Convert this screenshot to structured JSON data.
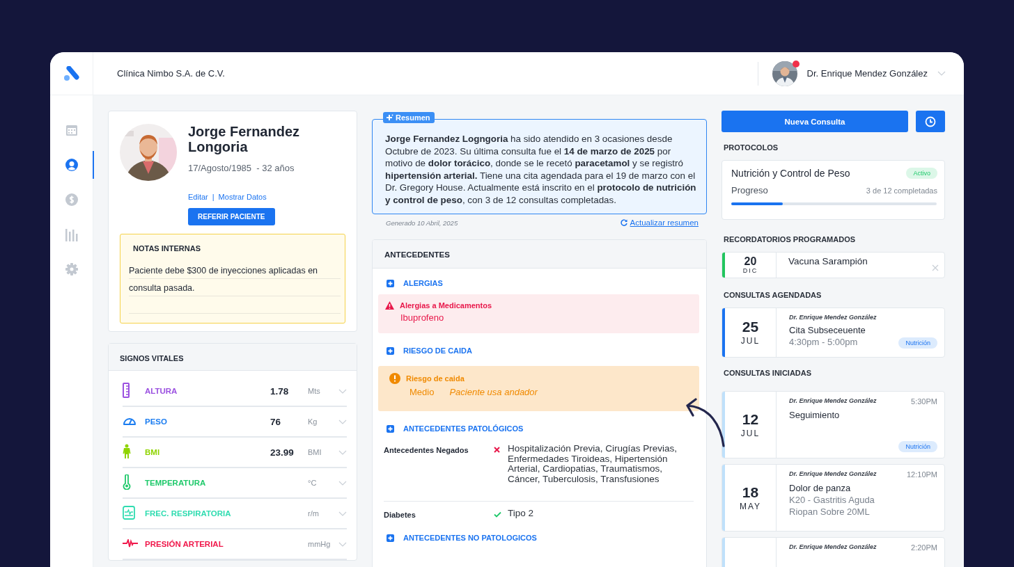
{
  "header": {
    "clinic": "Clínica Nimbo S.A. de C.V.",
    "user": "Dr. Enrique Mendez González",
    "notification": true
  },
  "sidebar": {
    "items": [
      {
        "kind": "calendar",
        "selected": false
      },
      {
        "kind": "user",
        "selected": true
      },
      {
        "kind": "money",
        "selected": false
      },
      {
        "kind": "chart",
        "selected": false
      },
      {
        "kind": "settings",
        "selected": false
      }
    ]
  },
  "patient": {
    "name": "Jorge Fernandez Longoria",
    "birth": "17/Agosto/1985  - 32 años",
    "links": [
      "Editar",
      "Mostrar Datos"
    ],
    "separator": "|",
    "button": "REFERIR PACIENTE",
    "notes": {
      "title": "NOTAS INTERNAS",
      "text": "Paciente debe $300 de inyecciones aplicadas en consulta pasada."
    }
  },
  "vitals": {
    "title": "SIGNOS VITALES",
    "rows": [
      {
        "kind": "ruler",
        "label": "ALTURA",
        "value": "1.78",
        "unit": "Mts",
        "color": "#9b51e0"
      },
      {
        "kind": "gauge",
        "label": "PESO",
        "value": "76",
        "unit": "Kg",
        "color": "#1a7cf0"
      },
      {
        "kind": "body",
        "label": "BMI",
        "value": "23.99",
        "unit": "BMI",
        "color": "#8fd400"
      },
      {
        "kind": "thermometer",
        "label": "TEMPERATURA",
        "unit": "°C",
        "color": "#1ec96a"
      },
      {
        "kind": "monitor",
        "label": "FREC. RESPIRATORIA",
        "unit": "r/m",
        "color": "#2fdcb0"
      },
      {
        "kind": "pulse",
        "label": "PRESIÓN ARTERIAL",
        "unit": "mmHg",
        "color": "#f0174a"
      }
    ]
  },
  "summary": {
    "badge": "Resumen",
    "text": "**Jorge Fernandez Logngoria** ha sido atendido en 3 ocasiones desde Octubre de 2023. Su última consulta fue el **14 de marzo de 2025** por motivo de **dolor torácico**, donde se le recetó **paracetamol** y se registró **hipertensión arterial.** Tiene una cita agendada para el 19 de marzo con el Dr. Gregory House. Actualmente está inscrito en el **protocolo de nutrición y control de peso**, con 3 de 12 consultas completadas.",
    "generated": "Generado 10 Abril, 2025",
    "refresh": "Actualizar resumen"
  },
  "antecedentes": {
    "title": "ANTECEDENTES",
    "sections": [
      {
        "title": "ALERGIAS",
        "kind": "danger",
        "alert_title": "Alergias a Medicamentos",
        "value": "Ibuprofeno"
      },
      {
        "title": "RIESGO DE CAIDA",
        "kind": "warning",
        "alert_title": "Riesgo de caida",
        "value": "Medio",
        "note": "Paciente usa andador"
      },
      {
        "title": "ANTECEDENTES PATOLÓGICOS",
        "kind": "list",
        "rows": [
          {
            "label": "Antecedentes Negados",
            "negated": true,
            "text": "Hospitalización Previa, Cirugías Previas, Enfermedades Tiroideas, Hipertensión Arterial, Cardiopatias, Traumatismos, Cáncer, Tuberculosis, Transfusiones"
          },
          {
            "label": "Diabetes",
            "negated": false,
            "text": "Tipo 2"
          }
        ]
      },
      {
        "title": "ANTECEDENTES NO PATOLOGICOS",
        "kind": "collapsed"
      }
    ]
  },
  "actions": {
    "new": "Nueva Consulta"
  },
  "protocols": {
    "title": "PROTOCOLOS",
    "items": [
      {
        "name": "Nutrición y Control de Peso",
        "status": "Activo",
        "progress_label": "Progreso",
        "count": "3 de 12 completadas",
        "level": 0.25
      }
    ]
  },
  "reminders": {
    "title": "RECORDATORIOS PROGRAMADOS",
    "items": [
      {
        "day": "20",
        "month": "DIC",
        "title": "Vacuna Sarampión",
        "color": "#22c55e"
      }
    ]
  },
  "scheduled": {
    "title": "CONSULTAS AGENDADAS",
    "items": [
      {
        "day": "25",
        "month": "JUL",
        "doctor": "Dr. Enrique Mendez González",
        "title": "Cita Subseceuente",
        "details": [
          "4:30pm - 5:00pm"
        ],
        "tag": "Nutrición",
        "color": "#1a73f0"
      }
    ]
  },
  "started": {
    "title": "CONSULTAS INICIADAS",
    "items": [
      {
        "day": "12",
        "month": "JUL",
        "doctor": "Dr. Enrique Mendez González",
        "time": "5:30PM",
        "title": "Seguimiento",
        "tag": "Nutrición",
        "color": "#bfe0fb"
      },
      {
        "day": "18",
        "month": "MAY",
        "doctor": "Dr. Enrique Mendez González",
        "time": "12:10PM",
        "title": "Dolor de panza",
        "details": [
          "K20 - Gastritis Aguda",
          "Riopan Sobre 20ML"
        ],
        "color": "#bfe0fb"
      },
      {
        "doctor": "Dr. Enrique Mendez González",
        "time": "2:20PM",
        "color": "#bfe0fb"
      }
    ]
  }
}
